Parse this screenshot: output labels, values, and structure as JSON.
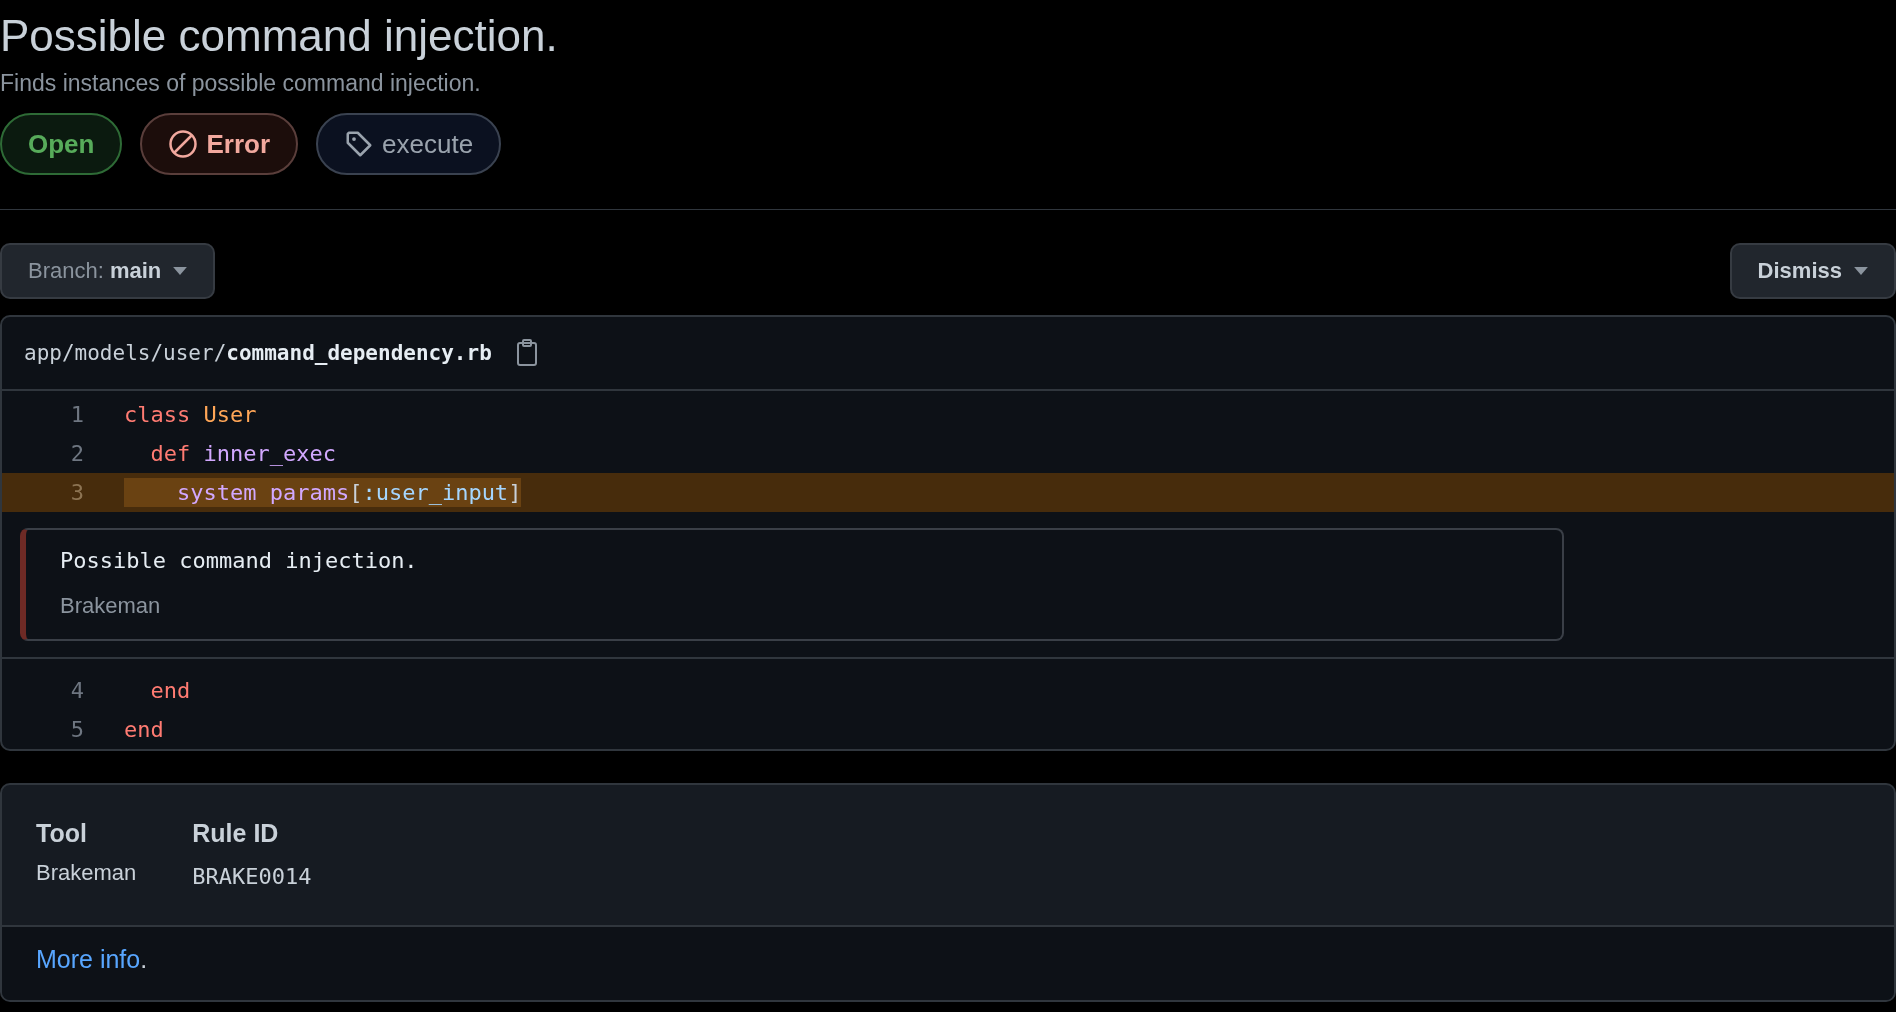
{
  "title": "Possible command injection.",
  "description": "Finds instances of possible command injection.",
  "badges": [
    {
      "kind": "state",
      "label": "Open"
    },
    {
      "kind": "severity",
      "label": "Error"
    },
    {
      "kind": "tag",
      "label": "execute"
    }
  ],
  "branch_button": {
    "label": "Branch:",
    "value": "main"
  },
  "dismiss_button": {
    "label": "Dismiss"
  },
  "file": {
    "path": "app/models/user/**command_dependency.rb**"
  },
  "code": [
    {
      "kind": "line",
      "number": "1",
      "highlighted": false,
      "tokens": [
        {
          "kind": "keyword",
          "text": "class"
        },
        {
          "kind": "constant",
          "text": " User"
        }
      ]
    },
    {
      "kind": "line",
      "number": "2",
      "highlighted": false,
      "tokens": [
        {
          "kind": "keyword",
          "text": "  def"
        },
        {
          "kind": "function",
          "text": " inner_exec"
        }
      ]
    },
    {
      "kind": "line",
      "number": "3",
      "highlighted": true,
      "tokens": [
        {
          "kind": "function",
          "text": "    system params"
        },
        {
          "kind": "plain",
          "text": "["
        },
        {
          "kind": "symbol",
          "text": ":user_input"
        },
        {
          "kind": "plain",
          "text": "]"
        }
      ]
    },
    {
      "kind": "alert",
      "message": "Possible command injection.",
      "tool": "Brakeman"
    },
    {
      "kind": "line",
      "number": "4",
      "highlighted": false,
      "tokens": [
        {
          "kind": "keyword",
          "text": "  end"
        }
      ]
    },
    {
      "kind": "line",
      "number": "5",
      "highlighted": false,
      "tokens": [
        {
          "kind": "keyword",
          "text": "end"
        }
      ]
    }
  ],
  "details": [
    {
      "kind": "text",
      "label": "Tool",
      "value": "Brakeman"
    },
    {
      "kind": "code",
      "label": "Rule ID",
      "value": "BRAKE0014"
    }
  ],
  "more_info": {
    "link": "More info",
    "suffix": "."
  }
}
